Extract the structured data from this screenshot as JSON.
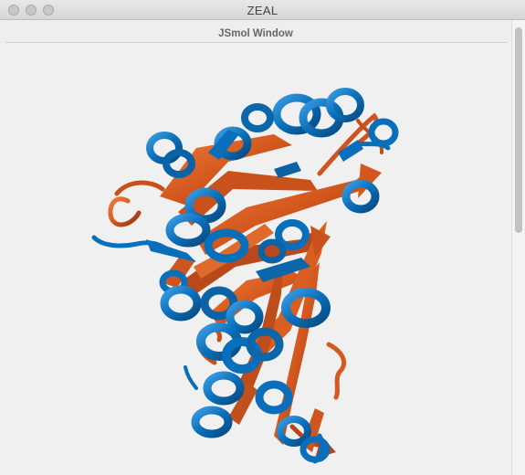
{
  "window": {
    "title": "ZEAL"
  },
  "panel": {
    "title": "JSmol Window"
  },
  "viewer": {
    "content": "protein-ribbon-superposition",
    "colors": {
      "structure_a": "#0a6fba",
      "structure_b": "#d4581d",
      "background": "#f0f0f0"
    }
  }
}
